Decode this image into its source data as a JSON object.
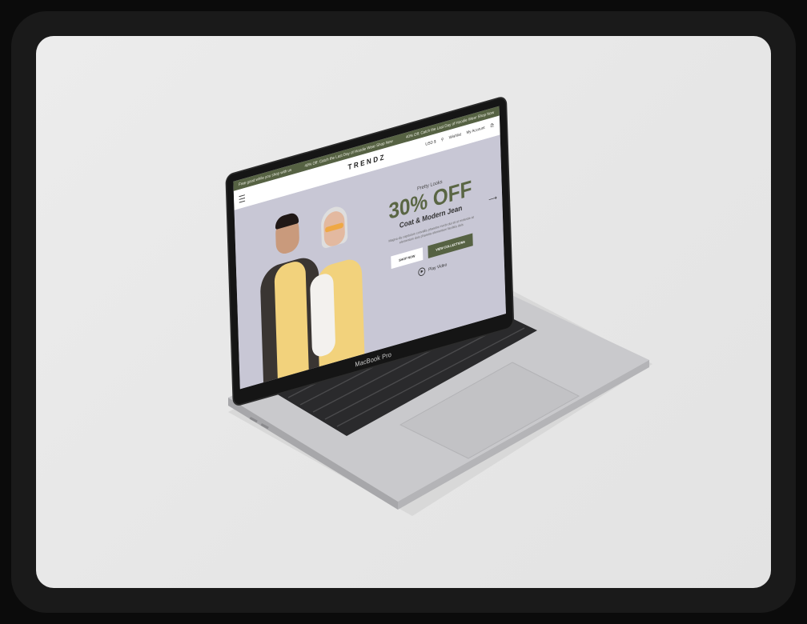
{
  "device": {
    "model_label": "MacBook Pro"
  },
  "site": {
    "announcement_left": "Free good while you shop with us",
    "announcement_center": "40% Off: Catch the Last Day of Hoodie Wear Shop Now",
    "announcement_right": "40% Off: Catch the Last Day of Hoodie Wear Shop Now",
    "logo": "TRENDZ",
    "currency": "USD $",
    "wishlist": "Wishlist",
    "account": "My Account",
    "hero": {
      "kicker": "Pretty Looks",
      "headline": "30% OFF",
      "subhead": "Coat & Modern Jean",
      "blurb": "Magna dis capitulum convallis pharetra morbi dui sit ut molestie at elementum duis pharetra elementum facilisis duis",
      "button_primary": "SHOP NOW",
      "button_secondary": "VIEW COLLECTIONS",
      "play_label": "Play Video"
    }
  },
  "colors": {
    "brand": "#566243",
    "hero_bg": "#c8c7d5",
    "card_bg": "#e9e9e9"
  }
}
